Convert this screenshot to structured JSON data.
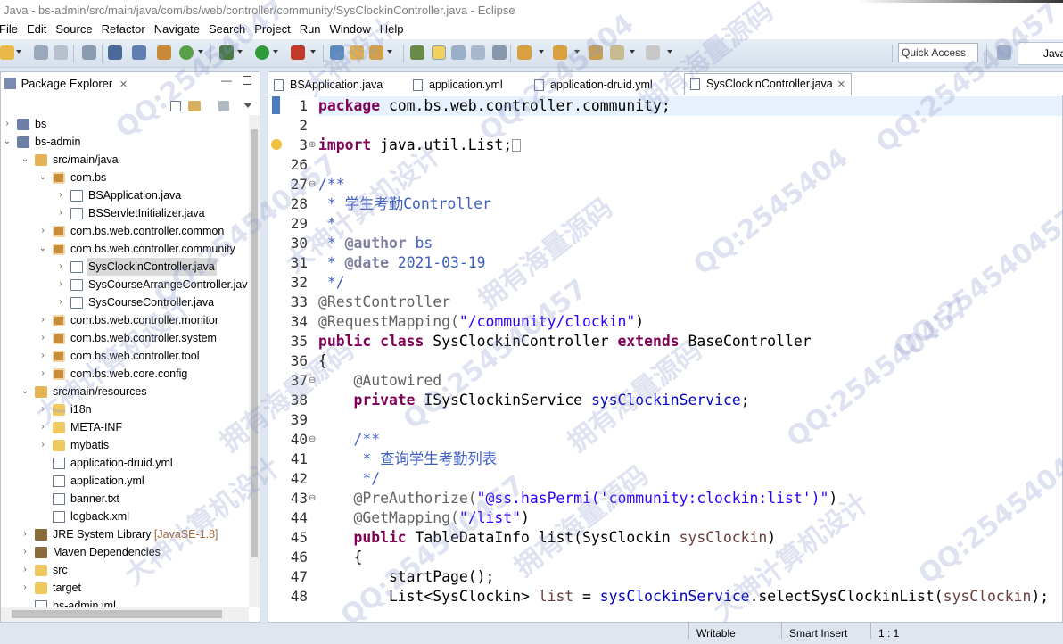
{
  "window": {
    "title": "Java - bs-admin/src/main/java/com/bs/web/controller/community/SysClockinController.java - Eclipse"
  },
  "menu": [
    "File",
    "Edit",
    "Source",
    "Refactor",
    "Navigate",
    "Search",
    "Project",
    "Run",
    "Window",
    "Help"
  ],
  "toolbar": {
    "quick_access": "Quick Access",
    "perspective": "Java"
  },
  "explorer": {
    "title": "Package Explorer",
    "tree": [
      {
        "label": "bs",
        "icon": "project-icon",
        "twisty": "›"
      },
      {
        "label": "bs-admin",
        "icon": "project-icon",
        "twisty": "⌄"
      },
      {
        "label": "src/main/java",
        "icon": "source-folder-icon",
        "twisty": "⌄"
      },
      {
        "label": "com.bs",
        "icon": "package-icon",
        "twisty": "⌄"
      },
      {
        "label": "BSApplication.java",
        "icon": "java-file-icon",
        "twisty": "›"
      },
      {
        "label": "BSServletInitializer.java",
        "icon": "java-file-icon",
        "twisty": "›"
      },
      {
        "label": "com.bs.web.controller.common",
        "icon": "package-icon",
        "twisty": "›"
      },
      {
        "label": "com.bs.web.controller.community",
        "icon": "package-icon",
        "twisty": "⌄"
      },
      {
        "label": "SysClockinController.java",
        "icon": "java-file-icon",
        "twisty": "›",
        "selected": true
      },
      {
        "label": "SysCourseArrangeController.jav",
        "icon": "java-file-icon",
        "twisty": "›"
      },
      {
        "label": "SysCourseController.java",
        "icon": "java-file-icon",
        "twisty": "›"
      },
      {
        "label": "com.bs.web.controller.monitor",
        "icon": "package-icon",
        "twisty": "›"
      },
      {
        "label": "com.bs.web.controller.system",
        "icon": "package-icon",
        "twisty": "›"
      },
      {
        "label": "com.bs.web.controller.tool",
        "icon": "package-icon",
        "twisty": "›"
      },
      {
        "label": "com.bs.web.core.config",
        "icon": "package-icon",
        "twisty": "›"
      },
      {
        "label": "src/main/resources",
        "icon": "source-folder-icon",
        "twisty": "⌄"
      },
      {
        "label": "i18n",
        "icon": "folder-icon",
        "twisty": "›"
      },
      {
        "label": "META-INF",
        "icon": "folder-icon",
        "twisty": "›"
      },
      {
        "label": "mybatis",
        "icon": "folder-icon",
        "twisty": "›"
      },
      {
        "label": "application-druid.yml",
        "icon": "yml-file-icon",
        "twisty": ""
      },
      {
        "label": "application.yml",
        "icon": "yml-file-icon",
        "twisty": ""
      },
      {
        "label": "banner.txt",
        "icon": "text-file-icon",
        "twisty": ""
      },
      {
        "label": "logback.xml",
        "icon": "xml-file-icon",
        "twisty": ""
      },
      {
        "label": "JRE System Library",
        "suffix": "[JavaSE-1.8]",
        "icon": "library-icon",
        "twisty": "›"
      },
      {
        "label": "Maven Dependencies",
        "icon": "library-icon",
        "twisty": "›"
      },
      {
        "label": "src",
        "icon": "folder-icon",
        "twisty": "›"
      },
      {
        "label": "target",
        "icon": "folder-icon",
        "twisty": "›"
      },
      {
        "label": "bs-admin.iml",
        "icon": "file-icon",
        "twisty": ""
      }
    ]
  },
  "editor": {
    "tabs": [
      {
        "label": "BSApplication.java"
      },
      {
        "label": "application.yml"
      },
      {
        "label": "application-druid.yml"
      },
      {
        "label": "SysClockinController.java",
        "active": true
      }
    ],
    "lines": [
      {
        "n": "1",
        "fold": ""
      },
      {
        "n": "2",
        "fold": ""
      },
      {
        "n": "3",
        "fold": "⊕"
      },
      {
        "n": "26",
        "fold": ""
      },
      {
        "n": "27",
        "fold": "⊖"
      },
      {
        "n": "28",
        "fold": ""
      },
      {
        "n": "29",
        "fold": ""
      },
      {
        "n": "30",
        "fold": ""
      },
      {
        "n": "31",
        "fold": ""
      },
      {
        "n": "32",
        "fold": ""
      },
      {
        "n": "33",
        "fold": ""
      },
      {
        "n": "34",
        "fold": ""
      },
      {
        "n": "35",
        "fold": ""
      },
      {
        "n": "36",
        "fold": ""
      },
      {
        "n": "37",
        "fold": "⊖"
      },
      {
        "n": "38",
        "fold": ""
      },
      {
        "n": "39",
        "fold": ""
      },
      {
        "n": "40",
        "fold": "⊖"
      },
      {
        "n": "41",
        "fold": ""
      },
      {
        "n": "42",
        "fold": ""
      },
      {
        "n": "43",
        "fold": "⊖"
      },
      {
        "n": "44",
        "fold": ""
      },
      {
        "n": "45",
        "fold": ""
      },
      {
        "n": "46",
        "fold": ""
      },
      {
        "n": "47",
        "fold": ""
      },
      {
        "n": "48",
        "fold": ""
      }
    ],
    "code": {
      "l1_kw": "package",
      "l1_rest": " com.bs.web.controller.community;",
      "l3_kw": "import",
      "l3_rest": " java.util.List;",
      "l27": "/**",
      "l28": " * 学生考勤Controller",
      "l29": " *",
      "l30_a": " * ",
      "l30_tag": "@author",
      "l30_b": " bs",
      "l31_a": " * ",
      "l31_tag": "@date",
      "l31_b": " 2021-03-19",
      "l32": " */",
      "l33": "@RestController",
      "l34_a": "@RequestMapping(",
      "l34_s": "\"/community/clockin\"",
      "l34_b": ")",
      "l35_k1": "public class",
      "l35_a": " SysClockinController ",
      "l35_k2": "extends",
      "l35_b": " BaseController",
      "l36": "{",
      "l37": "    @Autowired",
      "l38_k": "    private",
      "l38_a": " ISysClockinService ",
      "l38_f": "sysClockinService",
      "l38_b": ";",
      "l40": "    /**",
      "l41": "     * 查询学生考勤列表",
      "l42": "     */",
      "l43_a": "    @PreAuthorize(",
      "l43_s": "\"@ss.hasPermi('community:clockin:list')\"",
      "l43_b": ")",
      "l44_a": "    @GetMapping(",
      "l44_s": "\"/list\"",
      "l44_b": ")",
      "l45_k": "    public",
      "l45_a": " TableDataInfo list(SysClockin ",
      "l45_p": "sysClockin",
      "l45_b": ")",
      "l46": "    {",
      "l47": "        startPage();",
      "l48_a": "        List<SysClockin> ",
      "l48_p": "list",
      "l48_b": " = ",
      "l48_f": "sysClockinService",
      "l48_c": ".selectSysClockinList(",
      "l48_p2": "sysClockin",
      "l48_d": ");"
    }
  },
  "status": {
    "writable": "Writable",
    "insert": "Smart Insert",
    "position": "1 : 1"
  },
  "watermarks": [
    "QQ:25454047",
    "大神设计",
    "QQ:2545404",
    "拥有海量源码",
    "QQ:254540457",
    "QQ:254540457",
    "大神计算机设计",
    "拥有海量源码",
    "QQ:2545404",
    "QQ:254540457",
    "大神计算机设计",
    "拥有海量源码",
    "QQ:254540457",
    "拥有海量源码",
    "QQ:254540457",
    "大神计算机设计",
    "QQ:254540457",
    "拥有海量源码",
    "大神计算机设计",
    "QQ:25454045"
  ]
}
